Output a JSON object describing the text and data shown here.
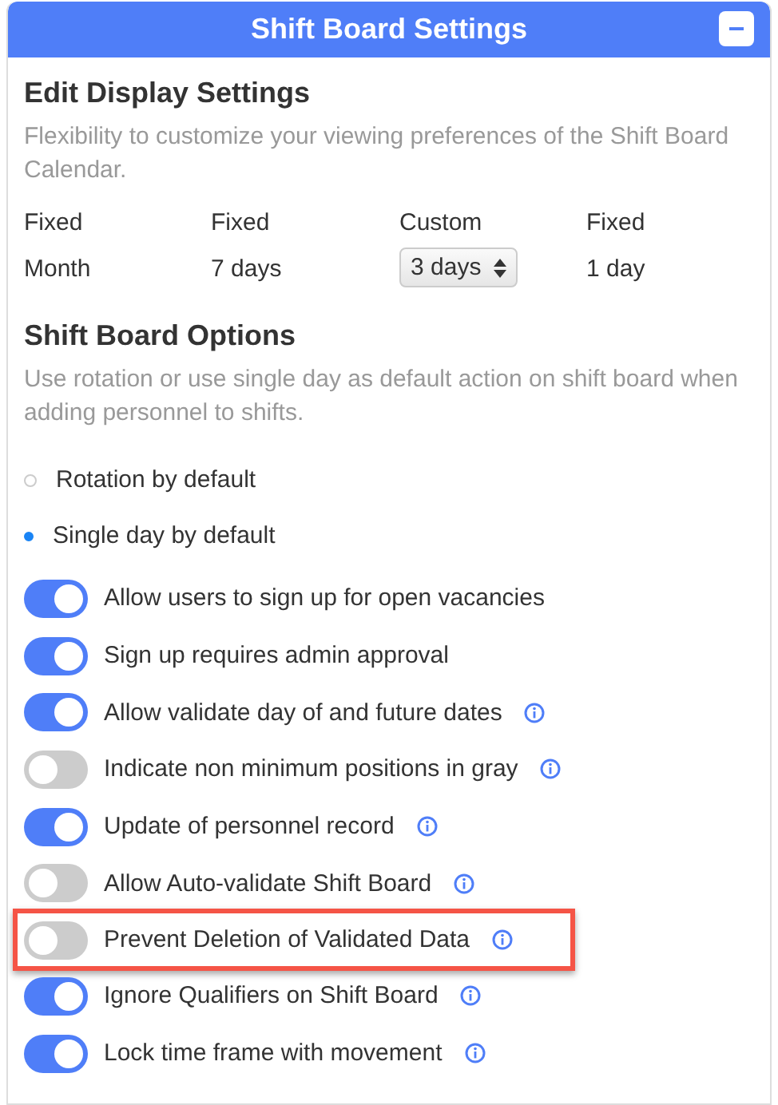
{
  "panel": {
    "title": "Shift Board Settings",
    "collapse": "−"
  },
  "display": {
    "heading": "Edit Display Settings",
    "description": "Flexibility to customize your viewing preferences of the Shift Board Calendar.",
    "columns": [
      {
        "kind": "fixed",
        "label": "Fixed",
        "value": "Month"
      },
      {
        "kind": "fixed",
        "label": "Fixed",
        "value": "7 days"
      },
      {
        "kind": "select",
        "label": "Custom",
        "value": "3 days"
      },
      {
        "kind": "fixed",
        "label": "Fixed",
        "value": "1 day"
      }
    ]
  },
  "options": {
    "heading": "Shift Board Options",
    "description": "Use rotation or use single day as default action on shift board when adding personnel to shifts.",
    "radios": [
      {
        "label": "Rotation by default",
        "selected": false
      },
      {
        "label": "Single day by default",
        "selected": true
      }
    ],
    "toggles": [
      {
        "label": "Allow users to sign up for open vacancies",
        "on": true,
        "info": false,
        "highlighted": false
      },
      {
        "label": "Sign up requires admin approval",
        "on": true,
        "info": false,
        "highlighted": false
      },
      {
        "label": "Allow validate day of and future dates",
        "on": true,
        "info": true,
        "highlighted": false
      },
      {
        "label": "Indicate non minimum positions in gray",
        "on": false,
        "info": true,
        "highlighted": false
      },
      {
        "label": "Update of personnel record",
        "on": true,
        "info": true,
        "highlighted": false
      },
      {
        "label": "Allow Auto-validate Shift Board",
        "on": false,
        "info": true,
        "highlighted": false
      },
      {
        "label": "Prevent Deletion of Validated Data",
        "on": false,
        "info": true,
        "highlighted": true
      },
      {
        "label": "Ignore Qualifiers on Shift Board",
        "on": true,
        "info": true,
        "highlighted": false
      },
      {
        "label": "Lock time frame with movement",
        "on": true,
        "info": true,
        "highlighted": false
      }
    ]
  }
}
